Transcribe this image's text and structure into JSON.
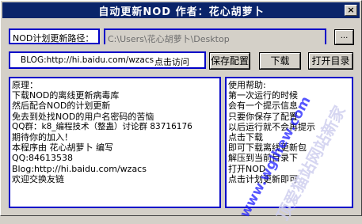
{
  "window": {
    "title": "自动更新NOD 作者：花心胡萝卜",
    "close_glyph": "×"
  },
  "path_row": {
    "label": "NOD计划更新路径：",
    "value": "C:\\Users\\花心胡萝卜\\Desktop",
    "browse_label": "..."
  },
  "blog_row": {
    "text": "BLOG:http://hi.baidu.com/wzacs",
    "visit_label": "点击访问"
  },
  "buttons": {
    "save": "保存配置",
    "download": "下载",
    "open_dir": "打开目录"
  },
  "left_panel": {
    "lines": [
      "原理：",
      "下载NOD的离线更新病毒库",
      "然后配合NOD的计划更新",
      "免去到处找NOD的用户名密码的苦恼",
      "QQ群：k8_编程技术（整蛊）讨论群   83716176",
      "期待你的加入！",
      "本程序由  花心胡萝卜  编写",
      "QQ:84613538",
      "Blog:http://hi.baidu.com/wzacs",
      "欢迎交换友链"
    ]
  },
  "right_panel": {
    "lines": [
      "使用帮助:",
      "第一次运行的时候",
      "会有一个提示信息",
      "只要你保存了配置",
      "以后运行就不会再提示",
      "点击下载",
      "即可下载离线更新包",
      "解压到当前目录下",
      "打开NOD",
      "点击计划更新即可"
    ]
  },
  "watermark": {
    "url": "www.wglhew.com",
    "site": "顶爱猫站网站新家"
  }
}
